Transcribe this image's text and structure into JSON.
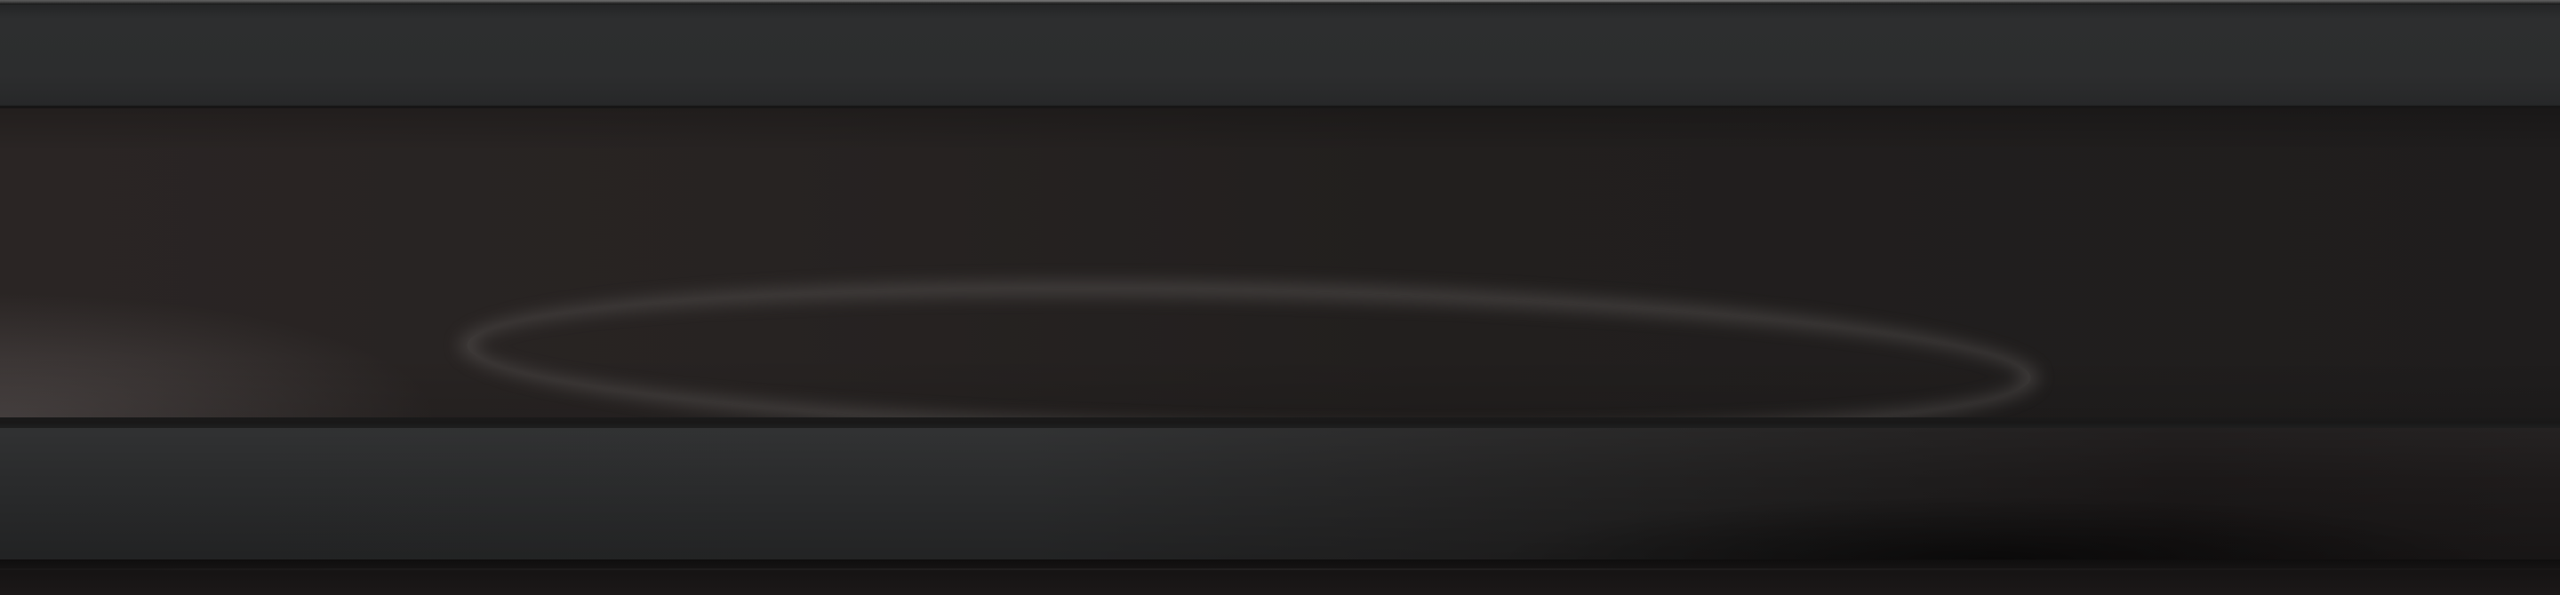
{
  "window": {
    "title": ""
  },
  "toolbar": {
    "items": []
  },
  "content": {
    "items": []
  },
  "status_bar": {
    "text": ""
  },
  "colors": {
    "toolbar": "#2c2d2e",
    "content": "#252120",
    "bottom_bar": "#282828",
    "highlight": "#3e3b3a"
  }
}
